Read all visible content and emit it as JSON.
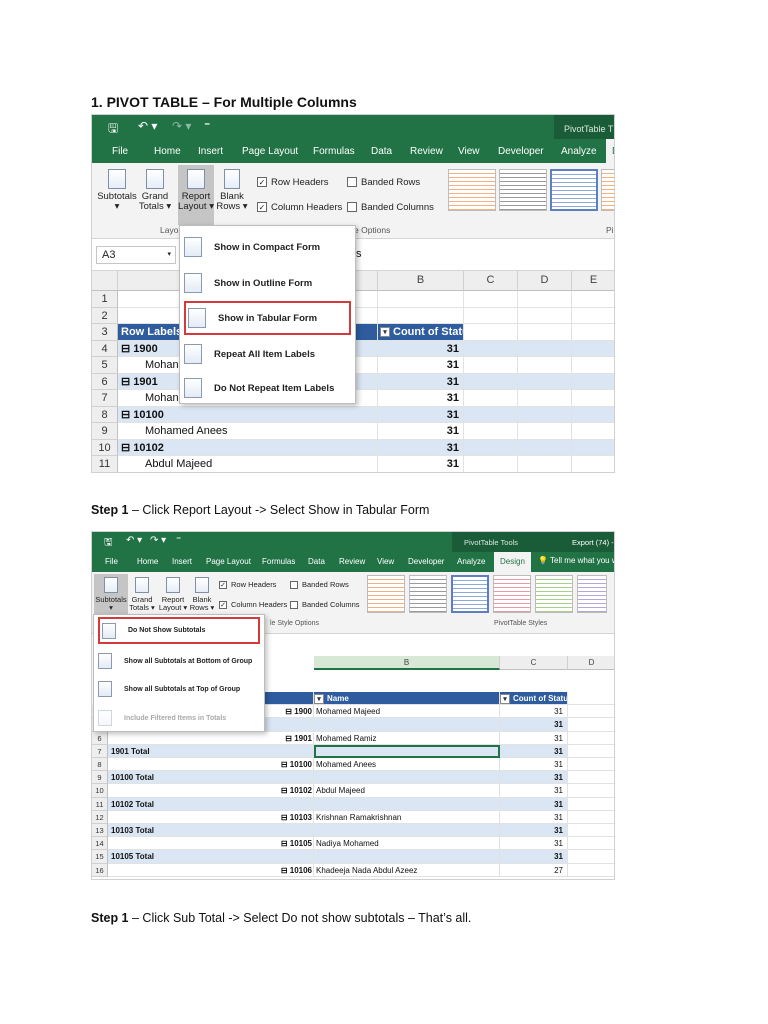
{
  "heading": "1. PIVOT TABLE – For Multiple Columns",
  "caption1": {
    "bold": "Step 1",
    "text": " – Click Report Layout -> Select Show in Tabular Form"
  },
  "caption2": {
    "bold": "Step 1",
    "text": " – Click Sub Total -> Select Do not show subtotals – That’s all."
  },
  "shot1": {
    "qat": {
      "save": "🖫",
      "undo": "↶ ▾",
      "redo": "↷ ▾",
      "more": "⁼",
      "context": "PivotTable T"
    },
    "tabs": [
      "File",
      "Home",
      "Insert",
      "Page Layout",
      "Formulas",
      "Data",
      "Review",
      "View",
      "Developer",
      "Analyze",
      "D"
    ],
    "ribbon": {
      "subtotals": "Subtotals",
      "subtotals_arrow": "▾",
      "grand_totals": "Grand",
      "grand_totals2": "Totals ▾",
      "report_layout": "Report",
      "report_layout2": "Layout ▾",
      "blank_rows": "Blank",
      "blank_rows2": "Rows ▾",
      "row_headers": "Row Headers",
      "banded_rows": "Banded Rows",
      "column_headers": "Column Headers",
      "banded_columns": "Banded Columns",
      "layout_group": "Layo",
      "style_options_group": "e Options",
      "pi_group": "Pi"
    },
    "namebox": "A3",
    "namebox_arrow": "▾",
    "formula_frag": "s",
    "columns": [
      "B",
      "C",
      "D",
      "E"
    ],
    "row_numbers": [
      "1",
      "2",
      "3",
      "4",
      "5",
      "6",
      "7",
      "8",
      "9",
      "10",
      "11"
    ],
    "header": {
      "row_labels": "Row Labels",
      "count": "Count of Status"
    },
    "rows": [
      {
        "label": "⊟ 1900",
        "value": "31"
      },
      {
        "label": "Mohan",
        "value": "31"
      },
      {
        "label": "⊟ 1901",
        "value": "31"
      },
      {
        "label": "Mohan",
        "value": "31"
      },
      {
        "label": "⊟ 10100",
        "value": "31"
      },
      {
        "label": "Mohamed Anees",
        "value": "31"
      },
      {
        "label": "⊟ 10102",
        "value": "31"
      },
      {
        "label": "Abdul Majeed",
        "value": "31"
      }
    ],
    "menu": [
      {
        "label": "Show in Compact Form"
      },
      {
        "label": "Show in Outline Form"
      },
      {
        "label": "Show in Tabular Form"
      },
      {
        "label": "Repeat All Item Labels"
      },
      {
        "label": "Do Not Repeat Item Labels"
      }
    ]
  },
  "shot2": {
    "qat": {
      "save": "🖫",
      "undo": "↶ ▾",
      "redo": "↷ ▾",
      "more": "⁼",
      "context": "PivotTable Tools",
      "title": "Export (74) -"
    },
    "tabs": [
      "File",
      "Home",
      "Insert",
      "Page Layout",
      "Formulas",
      "Data",
      "Review",
      "View",
      "Developer",
      "Analyze",
      "Design",
      "Tell me what you wa"
    ],
    "tell_me_icon": "💡",
    "ribbon": {
      "subtotals": "Subtotals",
      "subtotals_arrow": "▾",
      "grand_totals": "Grand",
      "grand_totals2": "Totals ▾",
      "report_layout": "Report",
      "report_layout2": "Layout ▾",
      "blank_rows": "Blank",
      "blank_rows2": "Rows ▾",
      "row_headers": "Row Headers",
      "banded_rows": "Banded Rows",
      "column_headers": "Column Headers",
      "banded_columns": "Banded Columns",
      "style_options_group": "le Style Options",
      "styles_group": "PivotTable Styles"
    },
    "columns": [
      "B",
      "C",
      "D"
    ],
    "menu": [
      {
        "label": "Do Not Show Subtotals"
      },
      {
        "label": "Show all Subtotals at Bottom of Group"
      },
      {
        "label": "Show all Subtotals at Top of Group"
      },
      {
        "label": "Include Filtered Items in Totals"
      }
    ],
    "header": {
      "name": "Name",
      "count": "Count of Status"
    },
    "rows": [
      {
        "num": "",
        "left": "",
        "code": "⊟ 1900",
        "name": "Mohamed Majeed",
        "value": "31",
        "band": false
      },
      {
        "num": "",
        "left": "",
        "code": "",
        "name": "",
        "value": "31",
        "band": true
      },
      {
        "num": "6",
        "left": "",
        "code": "⊟ 1901",
        "name": "Mohamed Ramiz",
        "value": "31",
        "band": false
      },
      {
        "num": "7",
        "left": "1901 Total",
        "code": "",
        "name": "",
        "value": "31",
        "band": true
      },
      {
        "num": "8",
        "left": "",
        "code": "⊟ 10100",
        "name": "Mohamed Anees",
        "value": "31",
        "band": false
      },
      {
        "num": "9",
        "left": "10100 Total",
        "code": "",
        "name": "",
        "value": "31",
        "band": true
      },
      {
        "num": "10",
        "left": "",
        "code": "⊟ 10102",
        "name": "Abdul Majeed",
        "value": "31",
        "band": false
      },
      {
        "num": "11",
        "left": "10102 Total",
        "code": "",
        "name": "",
        "value": "31",
        "band": true
      },
      {
        "num": "12",
        "left": "",
        "code": "⊟ 10103",
        "name": "Krishnan Ramakrishnan",
        "value": "31",
        "band": false
      },
      {
        "num": "13",
        "left": "10103 Total",
        "code": "",
        "name": "",
        "value": "31",
        "band": true
      },
      {
        "num": "14",
        "left": "",
        "code": "⊟ 10105",
        "name": "Nadiya Mohamed",
        "value": "31",
        "band": false
      },
      {
        "num": "15",
        "left": "10105 Total",
        "code": "",
        "name": "",
        "value": "31",
        "band": true
      },
      {
        "num": "16",
        "left": "",
        "code": "⊟ 10106",
        "name": "Khadeeja Nada Abdul Azeez",
        "value": "27",
        "band": false
      }
    ]
  },
  "colors": {
    "excel_green": "#217346",
    "pivot_header_blue": "#2e5c9e",
    "band_blue": "#dbe6f4",
    "highlight_red": "#d43a3a"
  }
}
